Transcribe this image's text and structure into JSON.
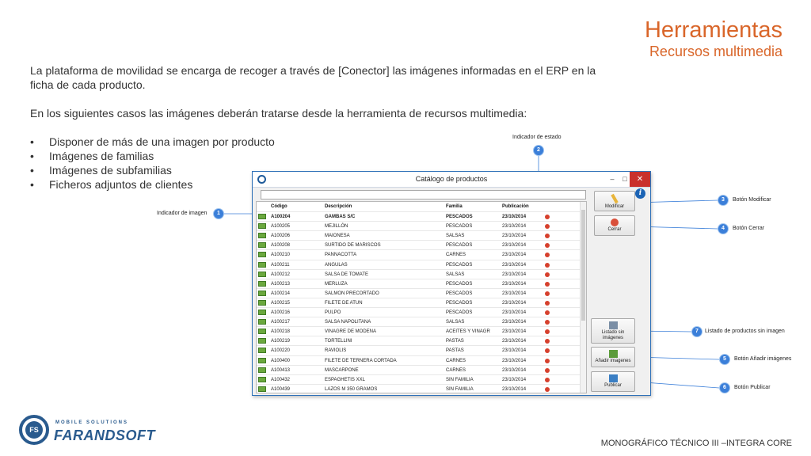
{
  "slide": {
    "title": "Herramientas",
    "subtitle": "Recursos multimedia",
    "paragraph1": "La plataforma de movilidad se encarga de recoger a través de [Conector] las imágenes informadas en el ERP en la ficha de cada producto.",
    "paragraph2": "En los siguientes casos las imágenes deberán tratarse desde la herramienta de recursos multimedia:",
    "bullets": [
      "Disponer de más de una imagen por producto",
      "Imágenes de familias",
      "Imágenes de subfamilias",
      "Ficheros adjuntos de clientes"
    ],
    "footer": "MONOGRÁFICO TÉCNICO III –INTEGRA CORE"
  },
  "logo": {
    "tagline": "MOBILE SOLUTIONS",
    "wordmark": "FARANDSOFT",
    "monogram": "FS"
  },
  "window": {
    "title": "Catálogo de productos",
    "controls": {
      "minimize": "–",
      "maximize": "□",
      "close": "✕"
    },
    "info_glyph": "i",
    "columns": {
      "code": "Código",
      "desc": "Descripción",
      "family": "Familia",
      "date": "Publicación"
    },
    "rows": [
      {
        "code": "A100204",
        "desc": "GAMBAS S/C",
        "family": "PESCADOS",
        "date": "23/10/2014"
      },
      {
        "code": "A100205",
        "desc": "MEJILLÓN",
        "family": "PESCADOS",
        "date": "23/10/2014"
      },
      {
        "code": "A100206",
        "desc": "MAIONESA",
        "family": "SALSAS",
        "date": "23/10/2014"
      },
      {
        "code": "A100208",
        "desc": "SURTIDO DE MARISCOS",
        "family": "PESCADOS",
        "date": "23/10/2014"
      },
      {
        "code": "A100210",
        "desc": "PANNACOTTA",
        "family": "CARNES",
        "date": "23/10/2014"
      },
      {
        "code": "A100211",
        "desc": "ANGULAS",
        "family": "PESCADOS",
        "date": "23/10/2014"
      },
      {
        "code": "A100212",
        "desc": "SALSA DE TOMATE",
        "family": "SALSAS",
        "date": "23/10/2014"
      },
      {
        "code": "A100213",
        "desc": "MERLUZA",
        "family": "PESCADOS",
        "date": "23/10/2014"
      },
      {
        "code": "A100214",
        "desc": "SALMON PRECORTADO",
        "family": "PESCADOS",
        "date": "23/10/2014"
      },
      {
        "code": "A100215",
        "desc": "FILETE DE ATUN",
        "family": "PESCADOS",
        "date": "23/10/2014"
      },
      {
        "code": "A100216",
        "desc": "PULPO",
        "family": "PESCADOS",
        "date": "23/10/2014"
      },
      {
        "code": "A100217",
        "desc": "SALSA NAPOLITANA",
        "family": "SALSAS",
        "date": "23/10/2014"
      },
      {
        "code": "A100218",
        "desc": "VINAGRE DE MODENA",
        "family": "ACEITES Y VINAGR",
        "date": "23/10/2014"
      },
      {
        "code": "A100219",
        "desc": "TORTELLINI",
        "family": "PASTAS",
        "date": "23/10/2014"
      },
      {
        "code": "A100220",
        "desc": "RAVIOLIS",
        "family": "PASTAS",
        "date": "23/10/2014"
      },
      {
        "code": "A100400",
        "desc": "FILETE DE TERNERA CORTADA",
        "family": "CARNES",
        "date": "23/10/2014"
      },
      {
        "code": "A100413",
        "desc": "MASCARPONE",
        "family": "CARNES",
        "date": "23/10/2014"
      },
      {
        "code": "A100432",
        "desc": "ESPAGHETIS XXL",
        "family": "SIN FAMILIA",
        "date": "23/10/2014"
      },
      {
        "code": "A100439",
        "desc": "LAZOS M 350 GRAMOS",
        "family": "SIN FAMILIA",
        "date": "23/10/2014"
      }
    ],
    "buttons": {
      "modify": "Modificar",
      "close": "Cerrar",
      "list_line1": "Listado sin",
      "list_line2": "imágenes",
      "add": "Añadir imagenes",
      "publish": "Publicar"
    }
  },
  "callouts": [
    {
      "num": "1",
      "label": "Indicador de imagen"
    },
    {
      "num": "2",
      "label": "Indicador de estado"
    },
    {
      "num": "3",
      "label": "Botón Modificar"
    },
    {
      "num": "4",
      "label": "Botón Cerrar"
    },
    {
      "num": "5",
      "label": "Botón Añadir imágenes"
    },
    {
      "num": "6",
      "label": "Botón Publicar"
    },
    {
      "num": "7",
      "label": "Listado de productos sin imagen"
    }
  ],
  "colors": {
    "accent": "#d9662a",
    "callout": "#3b7fd9",
    "window_border": "#2f71b8",
    "status_dot": "#d6402d",
    "image_indicator": "#6ba83e"
  }
}
